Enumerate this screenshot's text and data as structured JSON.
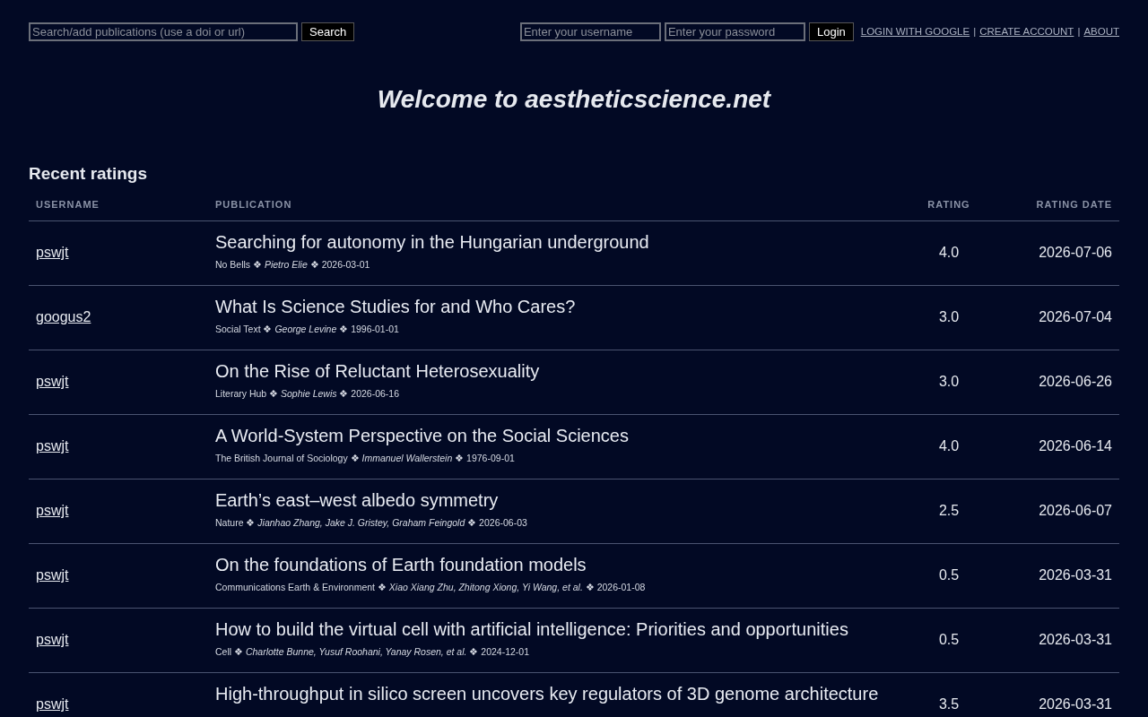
{
  "topbar": {
    "search": {
      "placeholder": "Search/add publications (use a doi or url)",
      "button": "Search"
    },
    "login": {
      "username_placeholder": "Enter your username",
      "password_placeholder": "Enter your password",
      "button": "Login"
    },
    "links": [
      "LOGIN WITH GOOGLE",
      "CREATE ACCOUNT",
      "ABOUT"
    ],
    "link_separator": "|"
  },
  "title": "Welcome to aestheticscience.net",
  "section_title": "Recent ratings",
  "table": {
    "columns": [
      "USERNAME",
      "PUBLICATION",
      "RATING",
      "RATING DATE"
    ],
    "rows": [
      {
        "username": "pswjt",
        "title": "Searching for autonomy in the Hungarian underground",
        "meta": "No Bells ❖ *Pietro Elie* ❖ 2026-03-01",
        "rating": "4.0",
        "date": "2026-07-06"
      },
      {
        "username": "googus2",
        "title": "What Is Science Studies for and Who Cares?",
        "meta": "Social Text ❖ *George Levine* ❖ 1996-01-01",
        "rating": "3.0",
        "date": "2026-07-04"
      },
      {
        "username": "pswjt",
        "title": "On the Rise of Reluctant Heterosexuality",
        "meta": "Literary Hub ❖ *Sophie Lewis* ❖ 2026-06-16",
        "rating": "3.0",
        "date": "2026-06-26"
      },
      {
        "username": "pswjt",
        "title": "A World-System Perspective on the Social Sciences",
        "meta": "The British Journal of Sociology ❖ *Immanuel Wallerstein* ❖ 1976-09-01",
        "rating": "4.0",
        "date": "2026-06-14"
      },
      {
        "username": "pswjt",
        "title": "Earth’s east–west albedo symmetry",
        "meta": "Nature ❖ *Jianhao Zhang, Jake J. Gristey, Graham Feingold* ❖ 2026-06-03",
        "rating": "2.5",
        "date": "2026-06-07"
      },
      {
        "username": "pswjt",
        "title": "On the foundations of Earth foundation models",
        "meta": "Communications Earth & Environment ❖ *Xiao Xiang Zhu, Zhitong Xiong, Yi Wang, et al.* ❖ 2026-01-08",
        "rating": "0.5",
        "date": "2026-03-31"
      },
      {
        "username": "pswjt",
        "title": "How to build the virtual cell with artificial intelligence: Priorities and opportunities",
        "meta": "Cell ❖ *Charlotte Bunne, Yusuf Roohani, Yanay Rosen, et al.* ❖ 2024-12-01",
        "rating": "0.5",
        "date": "2026-03-31"
      },
      {
        "username": "pswjt",
        "title": "High-throughput in silico screen uncovers key regulators of 3D genome architecture",
        "rating": "3.5",
        "date": "2026-03-31"
      }
    ]
  }
}
